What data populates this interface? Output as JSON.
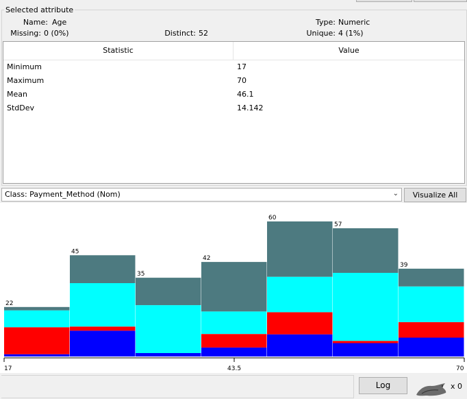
{
  "selected_attribute": {
    "legend": "Selected attribute",
    "name_label": "Name:",
    "name_value": "Age",
    "missing_label": "Missing:",
    "missing_value": "0 (0%)",
    "distinct_label": "Distinct:",
    "distinct_value": "52",
    "type_label": "Type:",
    "type_value": "Numeric",
    "unique_label": "Unique:",
    "unique_value": "4 (1%)"
  },
  "stats_table": {
    "columns": [
      "Statistic",
      "Value"
    ],
    "rows": [
      [
        "Minimum",
        "17"
      ],
      [
        "Maximum",
        "70"
      ],
      [
        "Mean",
        "46.1"
      ],
      [
        "StdDev",
        "14.142"
      ]
    ]
  },
  "class_selector": {
    "value": "Class: Payment_Method (Nom)"
  },
  "buttons": {
    "visualize_all": "Visualize All",
    "log": "Log"
  },
  "status": {
    "x_count": "x 0"
  },
  "colors": {
    "class_1": "#0000ff",
    "class_2": "#ff0000",
    "class_3": "#00ffff",
    "class_4": "#4d7a80"
  },
  "chart_data": {
    "type": "bar",
    "stacked": true,
    "x_ticks": [
      "17",
      "43.5",
      "70"
    ],
    "bin_totals": [
      22,
      45,
      35,
      42,
      60,
      57,
      39
    ],
    "series": [
      {
        "color": "#0000ff",
        "values": [
          2,
          25,
          3,
          8,
          20,
          12,
          17
        ]
      },
      {
        "color": "#ff0000",
        "values": [
          24,
          4,
          0,
          12,
          20,
          2,
          14
        ]
      },
      {
        "color": "#00ffff",
        "values": [
          15,
          42,
          42,
          20,
          32,
          61,
          32
        ]
      },
      {
        "color": "#4d7a80",
        "values": [
          3,
          27,
          24,
          44,
          50,
          40,
          16
        ]
      }
    ],
    "bin_labels": [
      "22",
      "45",
      "35",
      "42",
      "60",
      "57",
      "39"
    ]
  }
}
